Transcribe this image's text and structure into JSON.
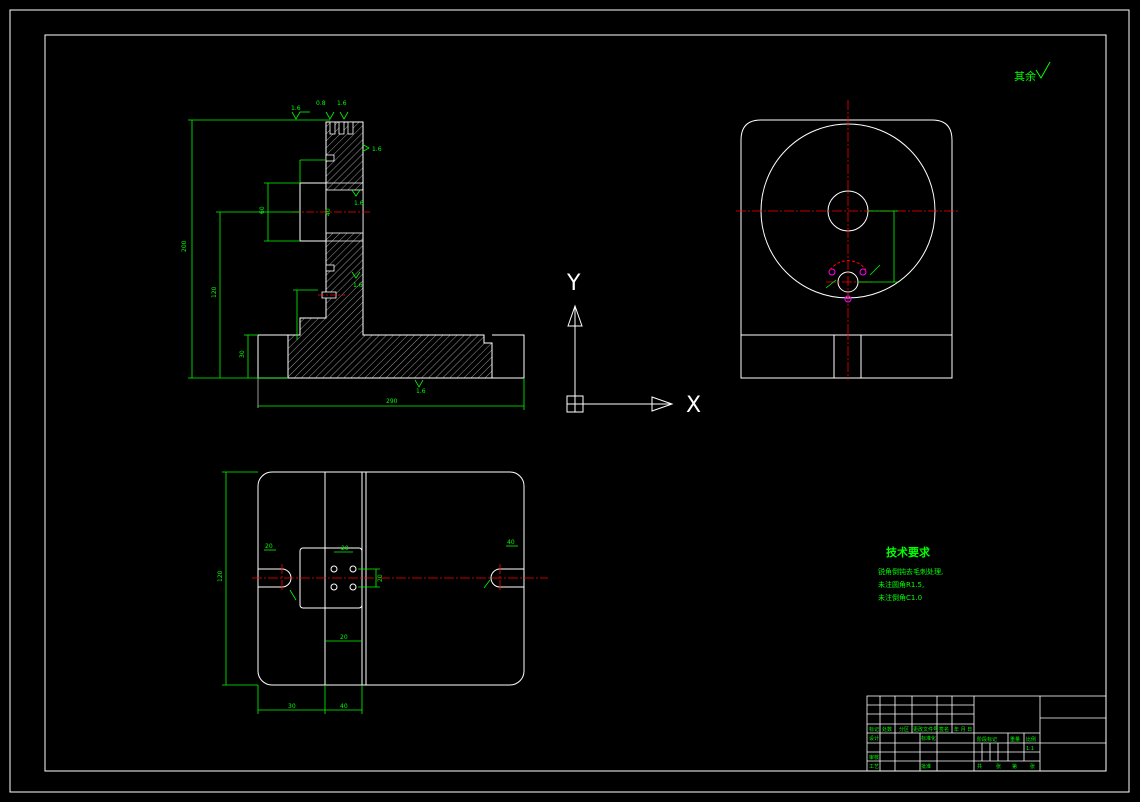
{
  "drawing": {
    "roughness_note": "其余",
    "tech_requirements": {
      "title": "技术要求",
      "lines": [
        "锐角倒钝去毛刺处理,",
        "未注圆角R1.5,",
        "未注倒角C1.0"
      ]
    },
    "ucs": {
      "x_label": "X",
      "y_label": "Y"
    },
    "dims": {
      "front": [
        "1.6",
        "0.8",
        "1.6",
        "1.6",
        "1.6",
        "1.6",
        "1.6",
        "200",
        "120",
        "60",
        "30",
        "40",
        "290"
      ],
      "top": [
        "120",
        "30",
        "40",
        "20",
        "20",
        "20",
        "20",
        "40"
      ]
    },
    "title_block": {
      "labels": [
        "标记",
        "处数",
        "分区",
        "更改文件号",
        "签名",
        "年 月 日",
        "设计",
        "标准化",
        "审核",
        "工艺",
        "批准",
        "阶段标记",
        "重量",
        "比例",
        "1:1",
        "共",
        "张",
        "第",
        "张"
      ]
    }
  },
  "colors": {
    "outline": "#ffffff",
    "dimension": "#00ff00",
    "center": "#ff0000",
    "hole": "#ff00ff",
    "background": "#000000"
  }
}
